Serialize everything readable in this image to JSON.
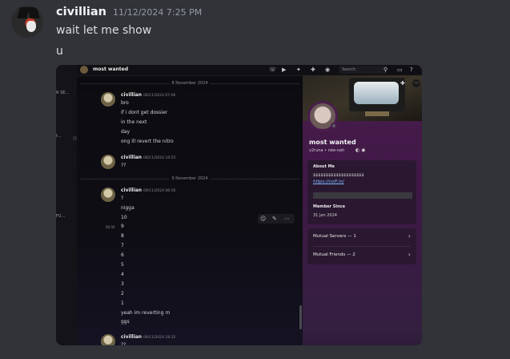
{
  "message": {
    "username": "civillian",
    "timestamp": "11/12/2024 7:25 PM",
    "lines": [
      "wait let me show",
      "u"
    ]
  },
  "screenshot": {
    "left_strip": [
      "R SE...",
      "t...",
      "FU..."
    ],
    "topbar": {
      "title": "most wanted",
      "search_placeholder": "Search"
    },
    "dividers": [
      "8 November 2024",
      "9 November 2024"
    ],
    "groups": [
      {
        "name": "civillian",
        "time": "08/11/2024 07:06",
        "lines": [
          "bro",
          "if i dont get dossier",
          "in the next",
          "day",
          "ong ill revert the nitro"
        ]
      },
      {
        "name": "civillian",
        "time": "08/11/2024 16:55",
        "lines": [
          "??"
        ]
      },
      {
        "name": "civillian",
        "time": "09/11/2024 06:56",
        "lines": [
          "?",
          "nigga",
          "10",
          "9",
          "8",
          "7",
          "6",
          "5",
          "4",
          "3",
          "2",
          "1",
          "yeah im reverting rn",
          "ggs"
        ]
      },
      {
        "name": "civillian",
        "time": "09/11/2024 18:32",
        "lines": [
          "??"
        ]
      }
    ],
    "hover_time": "06:56",
    "profile": {
      "display_name": "most wanted",
      "sub": "v2runa • née-nah",
      "about_heading": "About Me",
      "about_text": "$$$$$$$$$$$$$$$$$$$$",
      "about_link": "https://coff.in/",
      "member_heading": "Member Since",
      "member_since": "31 Jan 2024",
      "mutual_servers": "Mutual Servers — 1",
      "mutual_friends": "Mutual Friends — 2"
    }
  },
  "colors": {
    "background": "#313338",
    "username": "#f2f3f5",
    "timestamp": "#949ba4",
    "profile_bg": "#4a1d4d"
  }
}
